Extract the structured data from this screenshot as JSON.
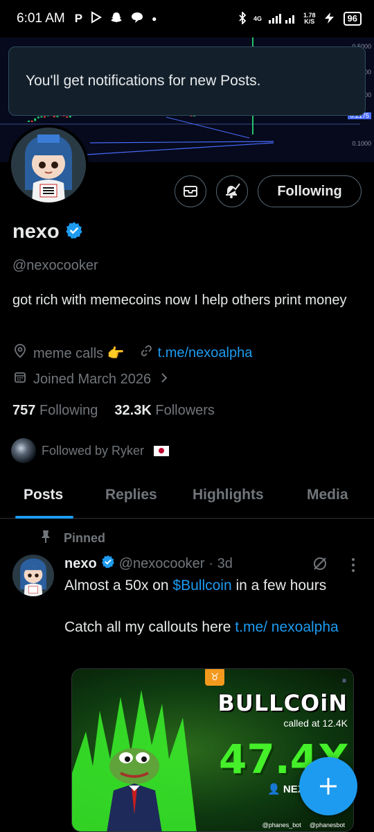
{
  "status_bar": {
    "time": "6:01 AM",
    "net_top": "4G",
    "speed_top": "1.78",
    "speed_unit": "K/S",
    "battery": "96",
    "app_icons": [
      "p-icon",
      "play-icon",
      "snapchat-icon",
      "chat-icon",
      "dot-icon"
    ]
  },
  "banner": {
    "axis": [
      "0.5000",
      "0.3000",
      "0.2000",
      "0.2175",
      "0.1000"
    ],
    "chart_data": {
      "type": "line",
      "title": "",
      "ylim": [
        0.1,
        0.5
      ]
    }
  },
  "toast": {
    "text": "You'll get notifications for new Posts."
  },
  "actions": {
    "follow_label": "Following"
  },
  "profile": {
    "name": "nexo",
    "handle": "@nexocooker",
    "bio": "got rich with memecoins now I help others print money",
    "location": "meme calls 👉",
    "link": "t.me/nexoalpha",
    "joined": "Joined March 2026",
    "following_count": "757",
    "following_label": "Following",
    "followers_count": "32.3K",
    "followers_label": "Followers",
    "followed_by": "Followed by Ryker"
  },
  "tabs": [
    "Posts",
    "Replies",
    "Highlights",
    "Media"
  ],
  "post": {
    "pinned_label": "Pinned",
    "name": "nexo",
    "handle": "@nexocooker",
    "time": "· 3d",
    "text1_prefix": "Almost a 50x on ",
    "text1_link": "$Bullcoin",
    "text1_suffix": " in a few hours",
    "text2_prefix": "Catch all my callouts here ",
    "text2_link": "t.me/ nexoalpha",
    "media": {
      "title": "BULLCOiN",
      "subtitle": "called at 12.4K",
      "multiplier": "47.4X",
      "user": "NEX",
      "foot1": "@phanes_bot",
      "foot2": "@phanesbot"
    }
  },
  "colors": {
    "accent": "#1d9bf0",
    "text": "#e7e9ea",
    "muted": "#71767b",
    "bg": "#000000"
  }
}
